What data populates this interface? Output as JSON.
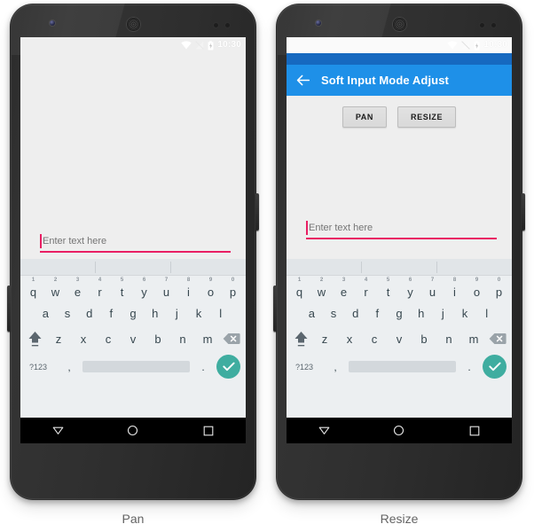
{
  "figure": {
    "captions": {
      "left": "Pan",
      "right": "Resize"
    }
  },
  "colors": {
    "accent_blue": "#1e90e8",
    "appbar_dark": "#1669c0",
    "pink_underline": "#E91E63",
    "enter_key_teal": "#3fada0",
    "screen_bg": "#eeeeee",
    "keyboard_bg": "#eceff1",
    "suggestion_bg": "#e1e5e8",
    "navbar_bg": "#000000"
  },
  "phones": [
    {
      "id": "pan",
      "statusbar": {
        "clock": "10:30",
        "icons": [
          "wifi-icon",
          "signal-off-icon",
          "battery-charging-icon"
        ],
        "background": "#eeeeee"
      },
      "has_appbar": false,
      "appbar": {
        "title": "",
        "back_label": ""
      },
      "buttons": [],
      "edittext": {
        "value": "",
        "placeholder": "Enter text here"
      },
      "navbar": [
        "back-nav-button",
        "home-nav-button",
        "recents-nav-button"
      ]
    },
    {
      "id": "resize",
      "statusbar": {
        "clock": "10:30",
        "icons": [
          "wifi-icon",
          "signal-off-icon",
          "battery-charging-icon"
        ],
        "background": "#fafafa"
      },
      "has_appbar": true,
      "appbar": {
        "title": "Soft Input Mode Adjust",
        "back_label": "Navigate up"
      },
      "buttons": [
        "PAN",
        "RESIZE"
      ],
      "edittext": {
        "value": "",
        "placeholder": "Enter text here"
      },
      "navbar": [
        "back-nav-button",
        "home-nav-button",
        "recents-nav-button"
      ]
    }
  ],
  "keyboard": {
    "suggestion_strip": {
      "items": [
        "",
        "",
        ""
      ]
    },
    "row1": {
      "letters": [
        "q",
        "w",
        "e",
        "r",
        "t",
        "y",
        "u",
        "i",
        "o",
        "p"
      ],
      "numbers": [
        "1",
        "2",
        "3",
        "4",
        "5",
        "6",
        "7",
        "8",
        "9",
        "0"
      ]
    },
    "row2": {
      "letters": [
        "a",
        "s",
        "d",
        "f",
        "g",
        "h",
        "j",
        "k",
        "l"
      ]
    },
    "row3": {
      "shift": "shift-key",
      "letters": [
        "z",
        "x",
        "c",
        "v",
        "b",
        "n",
        "m"
      ],
      "delete": "backspace-key"
    },
    "row4": {
      "symbols": "?123",
      "comma": ",",
      "space": "",
      "period": ".",
      "enter": "check-enter-key"
    }
  }
}
